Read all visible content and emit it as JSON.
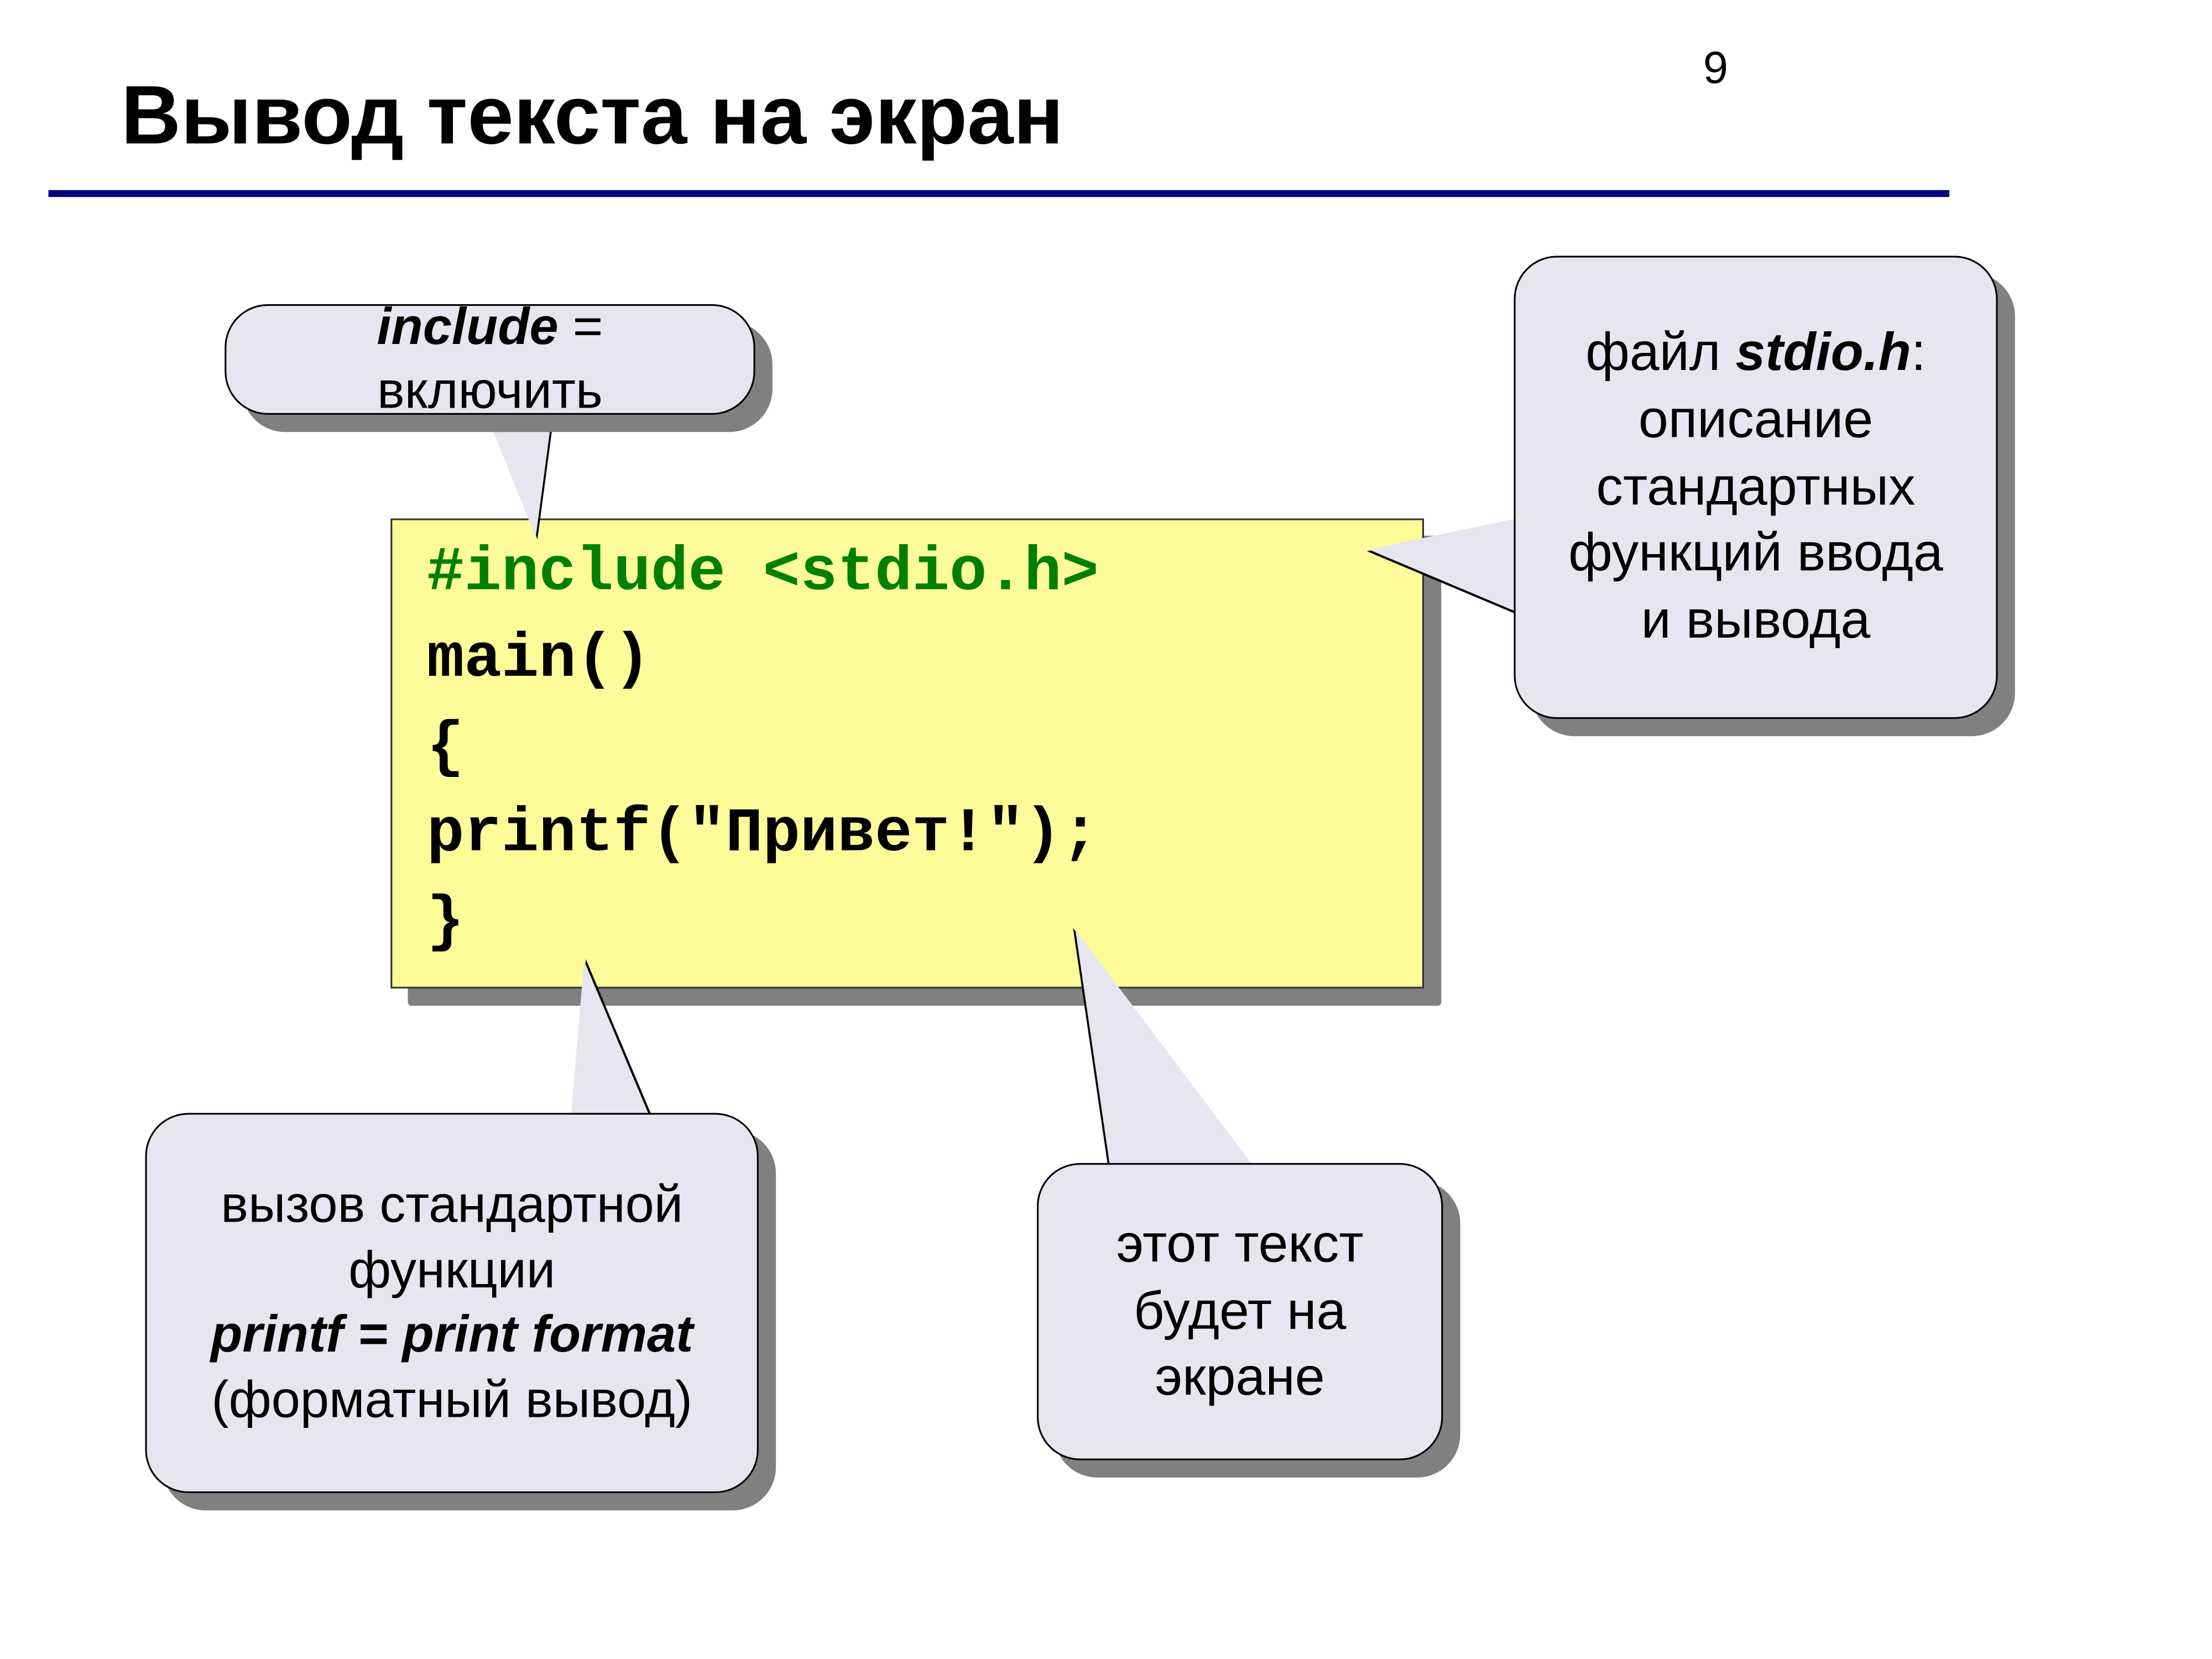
{
  "pageNumber": "9",
  "title": "Вывод текста на экран",
  "code": {
    "line1_include": "#include <stdio.h>",
    "line2": "main()",
    "line3": "{",
    "line4": "printf(\"Привет!\");",
    "line5": "}"
  },
  "callouts": {
    "include": {
      "prefix_bold_italic": "include",
      "rest": " = включить"
    },
    "stdio": {
      "line1_prefix": "файл ",
      "line1_bold_italic": "stdio.h",
      "line1_suffix": ":",
      "line2": "описание",
      "line3": "стандартных",
      "line4": "функций ввода",
      "line5": "и вывода"
    },
    "printf": {
      "line1": "вызов стандартной",
      "line2": "функции",
      "line3_bold_italic": "printf = print format",
      "line4": "(форматный вывод)"
    },
    "textOnScreen": {
      "line1": "этот текст",
      "line2": "будет на",
      "line3": "экране"
    }
  }
}
